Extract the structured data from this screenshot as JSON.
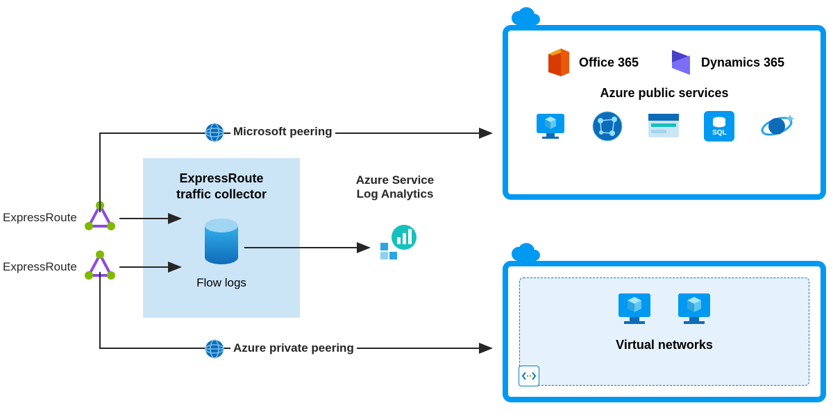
{
  "left": {
    "circuit1": "ExpressRoute",
    "circuit2": "ExpressRoute"
  },
  "collector": {
    "title_l1": "ExpressRoute",
    "title_l2": "traffic collector",
    "flow_logs": "Flow logs"
  },
  "peering": {
    "microsoft": "Microsoft peering",
    "private": "Azure private peering"
  },
  "log_analytics": {
    "title_l1": "Azure Service",
    "title_l2": "Log Analytics"
  },
  "public_cloud": {
    "office365": "Office 365",
    "dynamics365": "Dynamics 365",
    "section": "Azure public services",
    "services": [
      "screen-cube-icon",
      "network-icon",
      "browser-icon",
      "sql-icon",
      "cosmos-icon"
    ],
    "sql_label": "SQL"
  },
  "vnet_cloud": {
    "title": "Virtual networks"
  },
  "colors": {
    "azure_blue": "#0099f2",
    "panel_bg": "#cce5f6",
    "arrow": "#262626"
  }
}
